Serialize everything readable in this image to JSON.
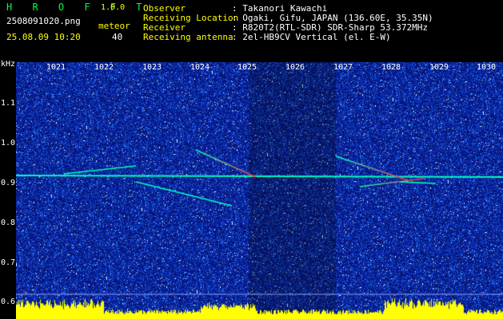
{
  "header": {
    "app_name": "H R O F F T",
    "version": "1.0.0",
    "filename": "2508091020.png",
    "mode_label": "meteor",
    "datetime": "25.08.09 10:20",
    "count": "40"
  },
  "info": {
    "observer_label": "Observer",
    "observer_value": ": Takanori Kawachi",
    "location_label": "Receiving Location",
    "location_value": ": Ogaki, Gifu, JAPAN (136.60E, 35.35N)",
    "receiver_label": "Receiver",
    "receiver_value": ": R820T2(RTL-SDR) SDR-Sharp 53.372MHz",
    "antenna_label": "Receiving antenna",
    "antenna_value": ": 2el-HB9CV Vertical (el. E-W)"
  },
  "axes": {
    "y_unit": "kHz",
    "y_ticks": [
      "1.1",
      "1.0",
      "0.9",
      "0.8",
      "0.7",
      "0.6"
    ],
    "x_ticks": [
      "1021",
      "1022",
      "1023",
      "1024",
      "1025",
      "1026",
      "1027",
      "1028",
      "1029",
      "1030"
    ]
  },
  "colors": {
    "background": "#000000",
    "spectrum_base": "#0a1aa0",
    "noise_light": "#2a58ff",
    "trace": "#00ffc0",
    "meteor_head": "#ff3050",
    "signal_bar": "#ffff00"
  }
}
